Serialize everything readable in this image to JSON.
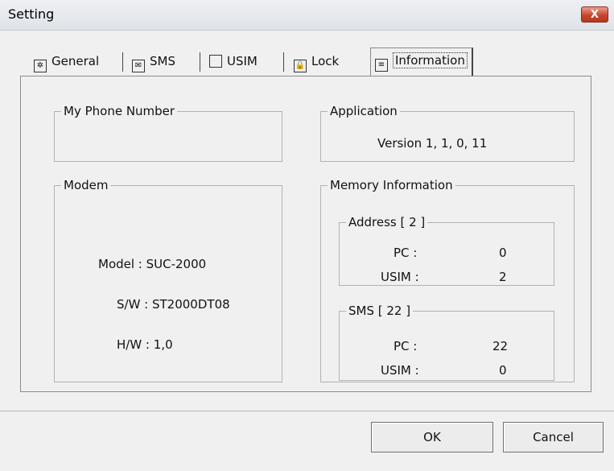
{
  "window": {
    "title": "Setting",
    "close_label": "X"
  },
  "tabs": [
    {
      "label": "General",
      "icon": "gear-icon"
    },
    {
      "label": "SMS",
      "icon": "envelope-icon"
    },
    {
      "label": "USIM",
      "icon": "sim-card-icon"
    },
    {
      "label": "Lock",
      "icon": "lock-icon"
    },
    {
      "label": "Information",
      "icon": "info-document-icon",
      "active": true
    }
  ],
  "phone": {
    "legend": "My Phone Number",
    "value": ""
  },
  "application": {
    "legend": "Application",
    "version": "Version 1, 1, 0, 11"
  },
  "modem": {
    "legend": "Modem",
    "model": "Model : SUC-2000",
    "sw": "S/W : ST2000DT08",
    "hw": "H/W : 1,0"
  },
  "memory": {
    "legend": "Memory Information",
    "address": {
      "legend": "Address   [ 2 ]",
      "pc_label": "PC :",
      "pc_value": "0",
      "usim_label": "USIM :",
      "usim_value": "2"
    },
    "sms": {
      "legend": "SMS   [ 22 ]",
      "pc_label": "PC :",
      "pc_value": "22",
      "usim_label": "USIM :",
      "usim_value": "0"
    }
  },
  "buttons": {
    "ok": "OK",
    "cancel": "Cancel"
  }
}
